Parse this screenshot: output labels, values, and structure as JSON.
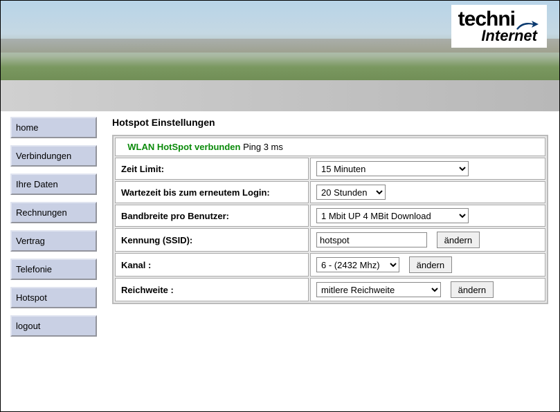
{
  "logo": {
    "top": "techni",
    "bottom": "Internet"
  },
  "sidebar": {
    "items": [
      {
        "label": "home"
      },
      {
        "label": "Verbindungen"
      },
      {
        "label": "Ihre Daten"
      },
      {
        "label": "Rechnungen"
      },
      {
        "label": "Vertrag"
      },
      {
        "label": "Telefonie"
      },
      {
        "label": "Hotspot"
      },
      {
        "label": "logout"
      }
    ]
  },
  "main": {
    "title": "Hotspot Einstellungen",
    "status": {
      "connected_label": "WLAN HotSpot verbunden",
      "ping_label": "Ping 3 ms"
    },
    "rows": {
      "time_limit": {
        "label": "Zeit Limit:",
        "value": "15 Minuten"
      },
      "wait_time": {
        "label": "Wartezeit bis zum erneutem Login:",
        "value": "20 Stunden"
      },
      "bandwidth": {
        "label": "Bandbreite pro Benutzer:",
        "value": "1 Mbit UP 4 MBit Download"
      },
      "ssid": {
        "label": "Kennung (SSID):",
        "value": "hotspot",
        "button": "ändern"
      },
      "channel": {
        "label": "Kanal :",
        "value": "6 - (2432 Mhz)",
        "button": "ändern"
      },
      "range": {
        "label": "Reichweite :",
        "value": "mitlere Reichweite",
        "button": "ändern"
      }
    }
  }
}
